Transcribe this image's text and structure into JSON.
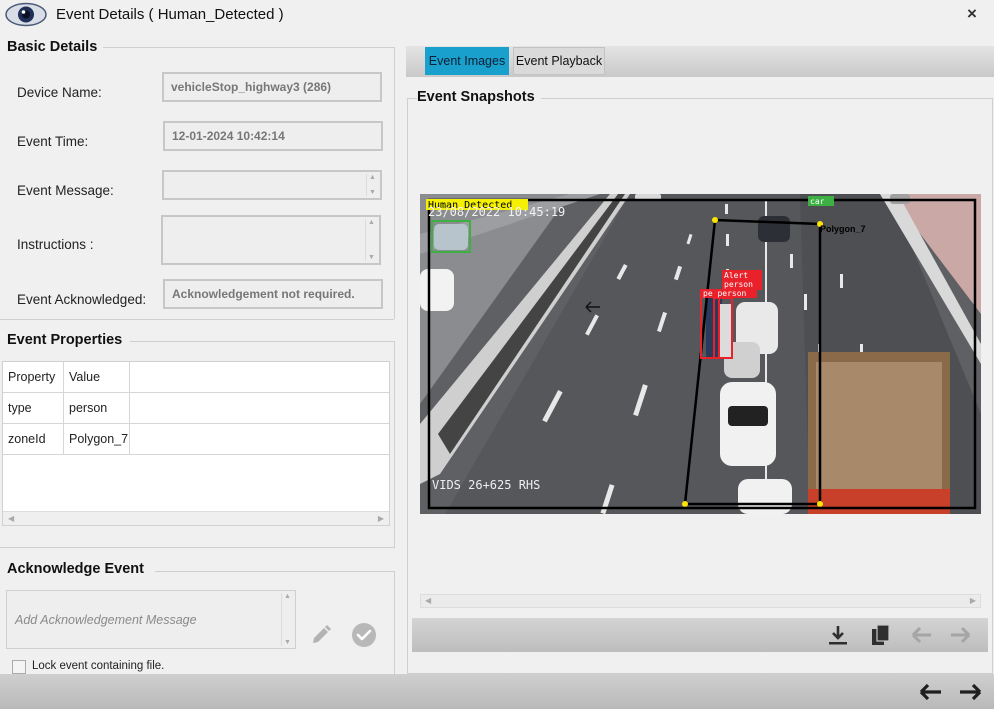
{
  "window": {
    "title": "Event Details ( Human_Detected )",
    "close_glyph": "×"
  },
  "basic_details": {
    "title": "Basic Details",
    "fields": [
      {
        "label": "Device Name:",
        "value": "vehicleStop_highway3 (286)"
      },
      {
        "label": "Event Time:",
        "value": "12-01-2024 10:42:14"
      },
      {
        "label": "Event Message:",
        "value": ""
      },
      {
        "label": "Instructions :",
        "value": ""
      },
      {
        "label": "Event Acknowledged:",
        "value": "Acknowledgement not required."
      }
    ]
  },
  "event_properties": {
    "title": "Event Properties",
    "columns": [
      "Property",
      "Value"
    ],
    "rows": [
      [
        "type",
        "person"
      ],
      [
        "zoneId",
        "Polygon_7"
      ]
    ]
  },
  "acknowledge": {
    "title": "Acknowledge Event",
    "placeholder": "Add Acknowledgement Message",
    "lock_label": "Lock event containing file.",
    "lock_checked": false
  },
  "tabs": [
    {
      "label": "Event Images",
      "active": true
    },
    {
      "label": "Event Playback",
      "active": false
    }
  ],
  "snapshots": {
    "title": "Event Snapshots",
    "overlay": {
      "event_label": "Human_Detected",
      "timestamp": "23/08/2022 10:45:19",
      "camera_label": "VIDS 26+625 RHS",
      "zone_label": "Polygon_7",
      "alert_label": "Alert",
      "person_label": "person",
      "person_label_2": "pe person",
      "car_label": "car"
    }
  },
  "icons": {
    "app": "eye-icon",
    "close": "close-icon",
    "edit": "pencil-icon",
    "confirm": "check-circle-icon",
    "download": "download-icon",
    "copy": "copy-icon",
    "prev_image": "arrow-left-icon",
    "next_image": "arrow-right-icon",
    "prev_event": "arrow-left-icon",
    "next_event": "arrow-right-icon"
  },
  "colors": {
    "active_tab": "#1aa0cc",
    "detection_red": "#e8212b",
    "event_label_bg": "#f4f000",
    "car_box": "#3cb043"
  }
}
